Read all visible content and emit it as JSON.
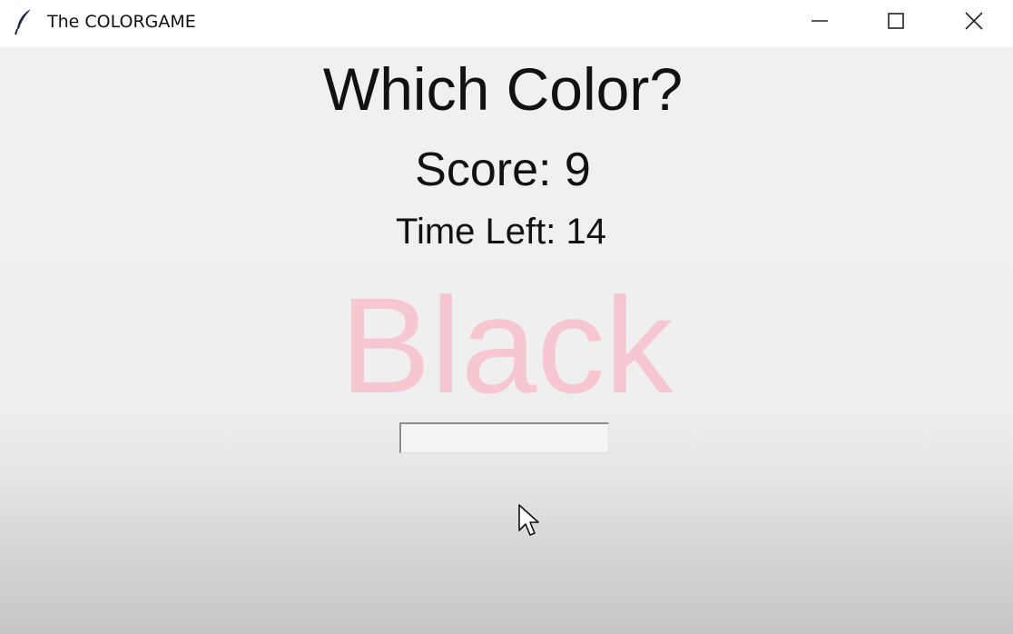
{
  "window": {
    "title": "The COLORGAME",
    "icon": "feather-icon",
    "controls": [
      "minimize-icon",
      "maximize-icon",
      "close-icon"
    ]
  },
  "game": {
    "heading": "Which Color?",
    "score_text": "Score: 9",
    "time_text": "Time Left: 14",
    "color_word": "Black",
    "color_word_color": "#f6c7d1",
    "answer_value": ""
  }
}
